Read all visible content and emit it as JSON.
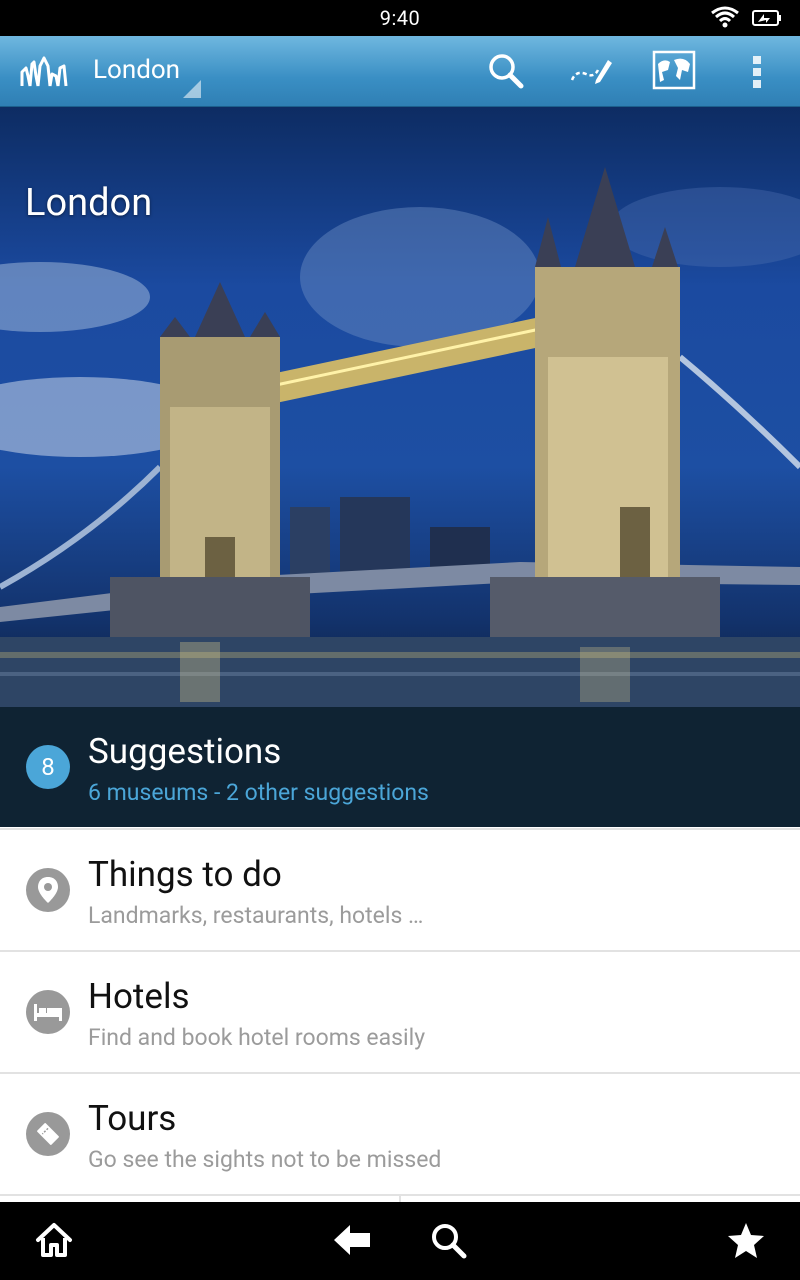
{
  "status_bar": {
    "time": "9:40"
  },
  "action_bar": {
    "logo": "skyline-logo-icon",
    "city": "London",
    "icons": [
      "search-icon",
      "route-edit-icon",
      "world-map-icon",
      "overflow-menu-icon"
    ]
  },
  "hero": {
    "title": "London"
  },
  "suggestions": {
    "count": "8",
    "title": "Suggestions",
    "subtitle": "6 museums - 2 other suggestions"
  },
  "list": [
    {
      "icon": "location-pin-icon",
      "title": "Things to do",
      "subtitle": "Landmarks, restaurants, hotels …"
    },
    {
      "icon": "bed-icon",
      "title": "Hotels",
      "subtitle": "Find and book hotel rooms easily"
    },
    {
      "icon": "ticket-icon",
      "title": "Tours",
      "subtitle": "Go see the sights not to be missed"
    }
  ],
  "bottom_nav": [
    "home-icon",
    "back-icon",
    "search-icon",
    "star-icon"
  ],
  "colors": {
    "actionbar": "#3a8fc4",
    "suggestions_bg": "#0f2333",
    "accent": "#4ba6d8",
    "subtitle_gray": "#9b9b9b"
  }
}
